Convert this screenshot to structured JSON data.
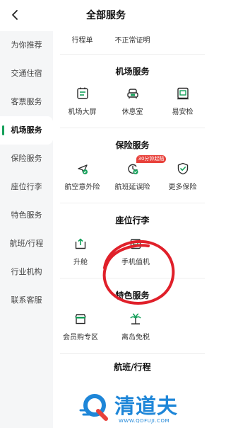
{
  "header": {
    "title": "全部服务"
  },
  "sidebar": {
    "items": [
      {
        "label": "为你推荐"
      },
      {
        "label": "交通住宿"
      },
      {
        "label": "客票服务"
      },
      {
        "label": "机场服务",
        "active": true
      },
      {
        "label": "保险服务"
      },
      {
        "label": "座位行李"
      },
      {
        "label": "特色服务"
      },
      {
        "label": "航班/行程"
      },
      {
        "label": "行业机构"
      },
      {
        "label": "联系客服"
      }
    ]
  },
  "main": {
    "partial_top": [
      {
        "label": "行程单"
      },
      {
        "label": "不正常证明"
      }
    ],
    "sections": [
      {
        "title": "机场服务",
        "items": [
          {
            "label": "机场大屏",
            "icon": "airport-screen-icon"
          },
          {
            "label": "休息室",
            "icon": "lounge-sofa-icon"
          },
          {
            "label": "易安检",
            "icon": "security-check-icon"
          }
        ]
      },
      {
        "title": "保险服务",
        "items": [
          {
            "label": "航空意外险",
            "icon": "flight-insurance-icon"
          },
          {
            "label": "航班延误险",
            "icon": "delay-insurance-icon",
            "badge": "30分钟起赔"
          },
          {
            "label": "更多保险",
            "icon": "shield-check-icon"
          }
        ]
      },
      {
        "title": "座位行李",
        "items": [
          {
            "label": "升舱",
            "icon": "upgrade-icon"
          },
          {
            "label": "手机值机",
            "icon": "mobile-checkin-icon"
          }
        ]
      },
      {
        "title": "特色服务",
        "items": [
          {
            "label": "会员购专区",
            "icon": "member-shop-icon"
          },
          {
            "label": "离岛免税",
            "icon": "island-dutyfree-icon"
          }
        ]
      },
      {
        "title": "航班/行程"
      }
    ]
  },
  "watermark": {
    "brand": "清道夫",
    "url": "WWW.QDFUJI.COM"
  },
  "colors": {
    "accent": "#15a05a",
    "badge": "#e8413b",
    "annotation": "#e0202a",
    "watermark": "#1e86d8"
  }
}
